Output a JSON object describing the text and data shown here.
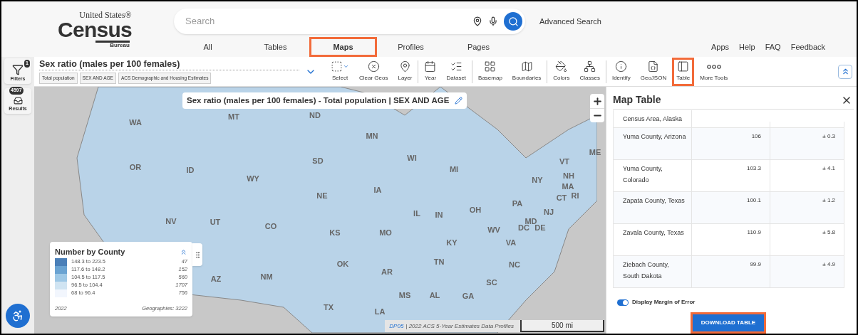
{
  "logo": {
    "line1": "United States®",
    "line2": "Census",
    "line3": "Bureau"
  },
  "search": {
    "placeholder": "Search",
    "advanced_link": "Advanced Search"
  },
  "nav_tabs": [
    {
      "label": "All",
      "selected": false
    },
    {
      "label": "Tables",
      "selected": false
    },
    {
      "label": "Maps",
      "selected": true
    },
    {
      "label": "Profiles",
      "selected": false
    },
    {
      "label": "Pages",
      "selected": false
    }
  ],
  "utility_links": [
    "Apps",
    "Help",
    "FAQ",
    "Feedback"
  ],
  "sidebar": [
    {
      "kind": "filters",
      "label": "Filters",
      "badge": "1"
    },
    {
      "kind": "results",
      "label": "Results",
      "badge": "4597"
    }
  ],
  "dataset": {
    "title": "Sex ratio (males per 100 females)",
    "chips": [
      "Total population",
      "SEX AND AGE",
      "ACS Demographic and Housing Estimates"
    ]
  },
  "tools": [
    {
      "kind": "select",
      "label": "Select",
      "selected": false,
      "divider_after": false
    },
    {
      "kind": "clear",
      "label": "Clear Geos",
      "selected": false,
      "divider_after": false
    },
    {
      "kind": "layer",
      "label": "Layer",
      "selected": false,
      "divider_after": true
    },
    {
      "kind": "year",
      "label": "Year",
      "selected": false,
      "divider_after": false
    },
    {
      "kind": "dataset",
      "label": "Dataset",
      "selected": false,
      "divider_after": true
    },
    {
      "kind": "basemap",
      "label": "Basemap",
      "selected": false,
      "divider_after": false
    },
    {
      "kind": "boundaries",
      "label": "Boundaries",
      "selected": false,
      "divider_after": true
    },
    {
      "kind": "colors",
      "label": "Colors",
      "selected": false,
      "divider_after": false
    },
    {
      "kind": "classes",
      "label": "Classes",
      "selected": false,
      "divider_after": true
    },
    {
      "kind": "identify",
      "label": "Identify",
      "selected": false,
      "divider_after": false
    },
    {
      "kind": "geojson",
      "label": "GeoJSON",
      "selected": false,
      "divider_after": false
    },
    {
      "kind": "table",
      "label": "Table",
      "selected": true,
      "divider_after": false
    },
    {
      "kind": "more",
      "label": "More Tools",
      "selected": false,
      "divider_after": false
    }
  ],
  "map": {
    "title": "Sex ratio (males per 100 females) - Total population | SEX AND AGE",
    "state_labels": [
      "WA",
      "MT",
      "ND",
      "MN",
      "SD",
      "WI",
      "VT",
      "ME",
      "OR",
      "ID",
      "WY",
      "MI",
      "NY",
      "NH",
      "NE",
      "IA",
      "CT",
      "MA",
      "RI",
      "IL",
      "IN",
      "OH",
      "PA",
      "NJ",
      "NV",
      "UT",
      "CO",
      "KS",
      "MO",
      "WV",
      "DC",
      "MD",
      "DE",
      "KY",
      "VA",
      "AZ",
      "NM",
      "OK",
      "AR",
      "TN",
      "SC",
      "NC",
      "MS",
      "AL",
      "GA",
      "TX",
      "LA"
    ],
    "legend": {
      "title": "Number by County",
      "entries": [
        {
          "range": "148.3 to 223.5",
          "count": "47",
          "color": "#4a7fb8"
        },
        {
          "range": "117.6 to 148.2",
          "count": "152",
          "color": "#6aa3d2"
        },
        {
          "range": "104.5 to 117.5",
          "count": "560",
          "color": "#9ec8e6"
        },
        {
          "range": "96.5 to 104.4",
          "count": "1707",
          "color": "#d0e4f2"
        },
        {
          "range": "68 to 96.4",
          "count": "756",
          "color": "#f2f6fd"
        }
      ],
      "year": "2022",
      "geographies": "Geographies: 3222"
    },
    "attribution": {
      "link": "DP05",
      "text": "| 2022 ACS 5-Year Estimates Data Profiles"
    },
    "scale": "500 mi"
  },
  "table_panel": {
    "title": "Map Table",
    "rows": [
      {
        "name": "Census Area, Alaska"
      },
      {
        "name": "Yuma County, Arizona",
        "value": "106",
        "moe": "± 0.3"
      },
      {
        "name": "Yuma County, Colorado",
        "value": "103.3",
        "moe": "± 4.1"
      },
      {
        "name": "Zapata County, Texas",
        "value": "100.1",
        "moe": "± 1.2"
      },
      {
        "name": "Zavala County, Texas",
        "value": "110.9",
        "moe": "± 5.8"
      },
      {
        "name": "Ziebach County, South Dakota",
        "value": "99.9",
        "moe": "± 4.9"
      }
    ],
    "moe_toggle": {
      "label": "Display Margin of Error",
      "on": true
    },
    "download_button": "DOWNLOAD TABLE"
  }
}
